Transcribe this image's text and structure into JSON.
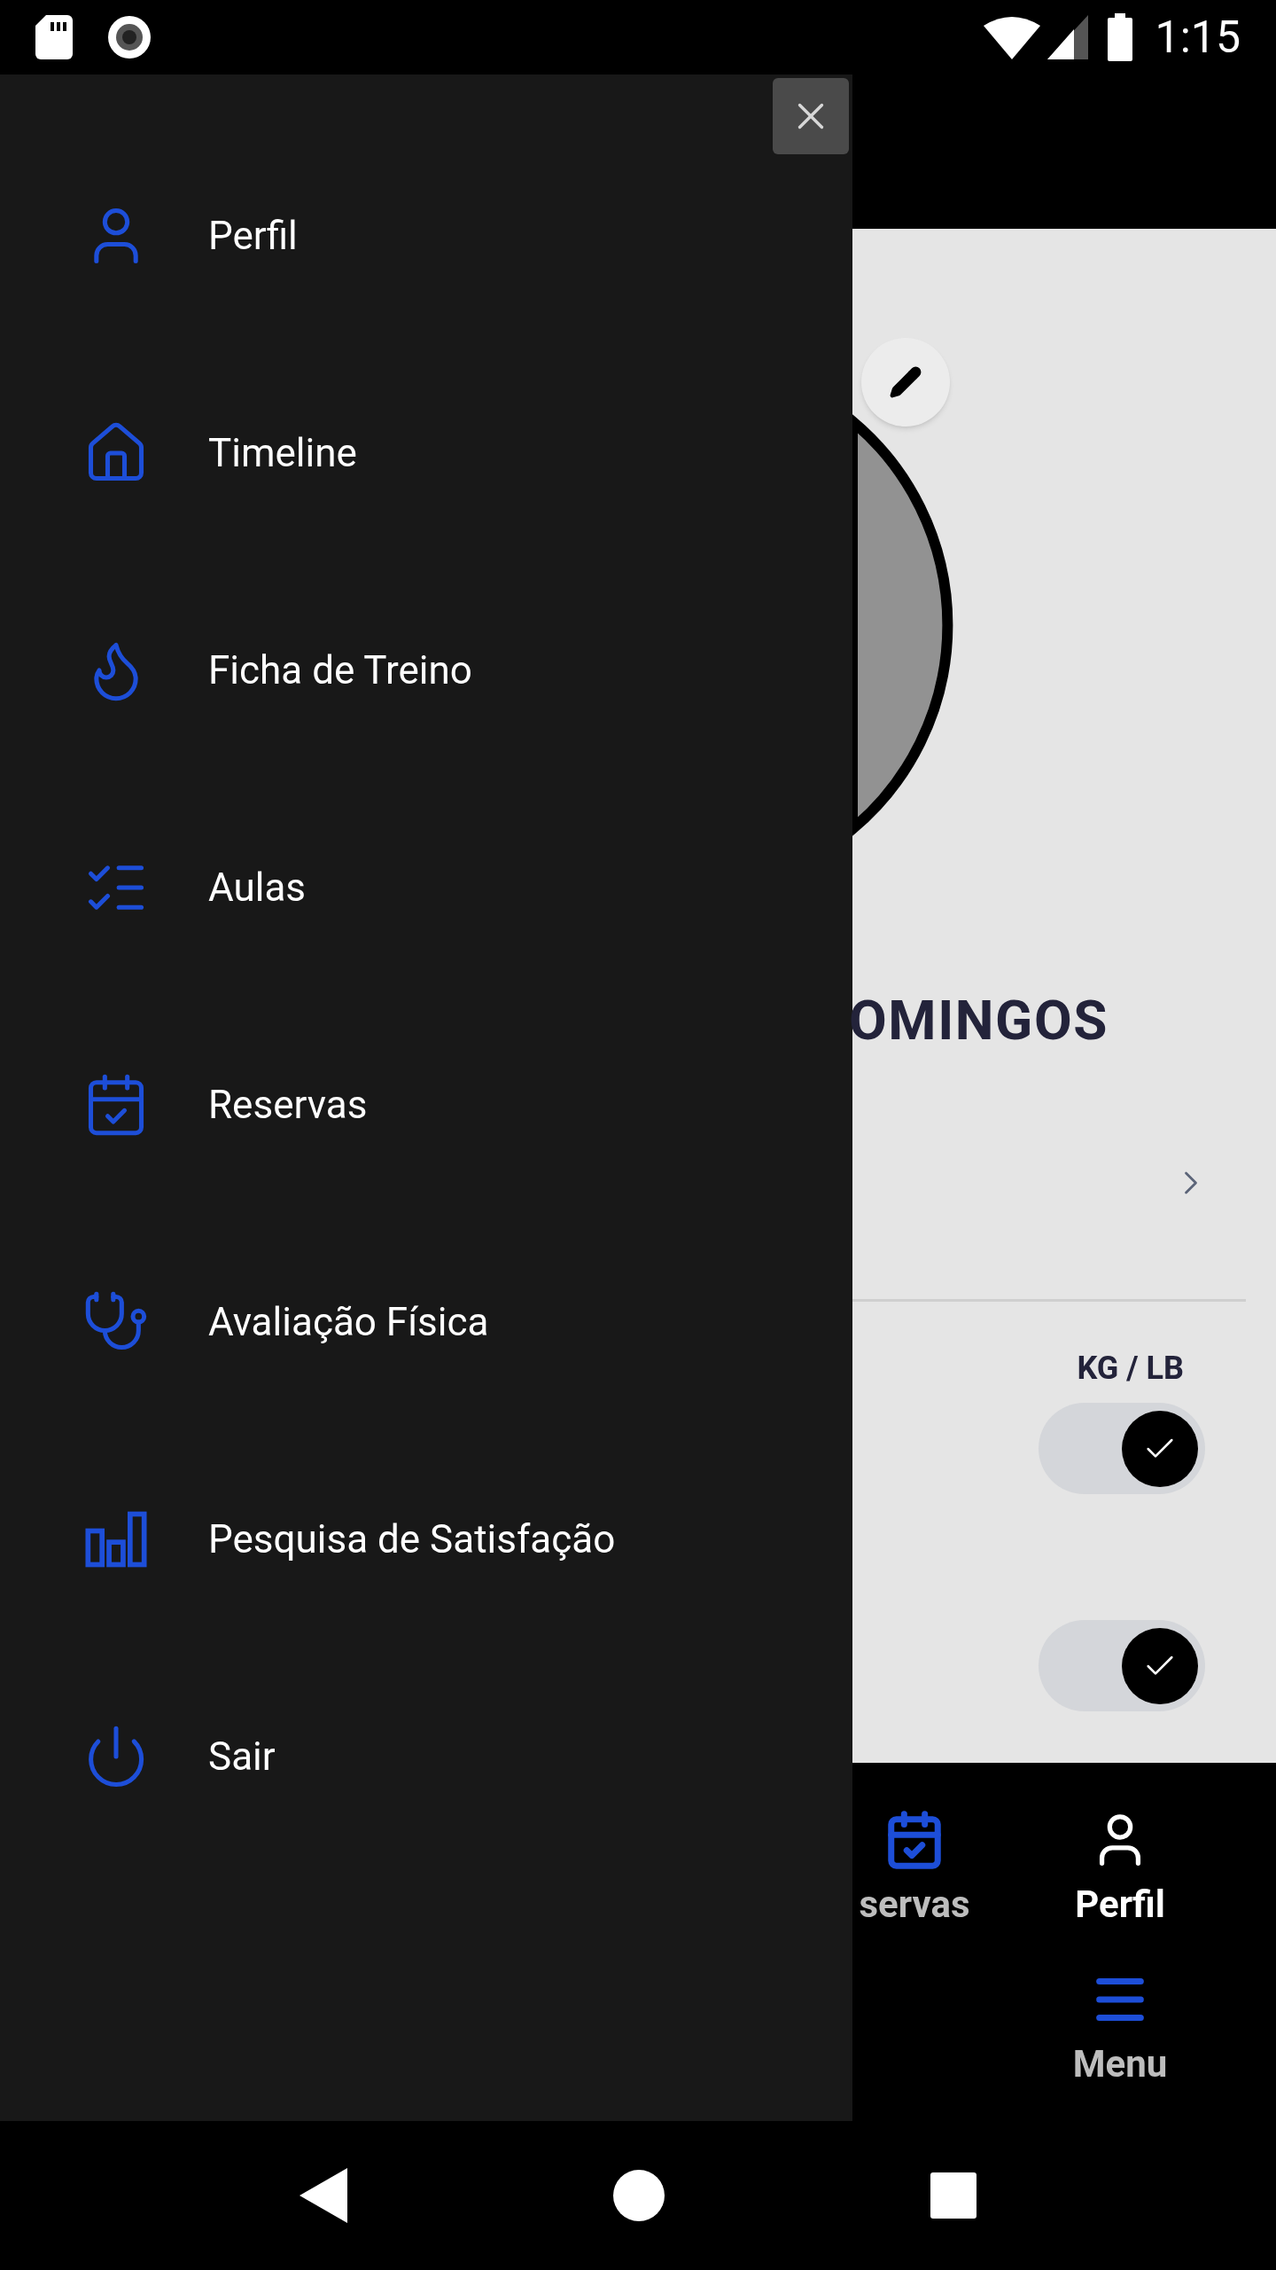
{
  "status_bar": {
    "time": "1:15"
  },
  "drawer": {
    "items": [
      {
        "label": "Perfil"
      },
      {
        "label": "Timeline"
      },
      {
        "label": "Ficha de Treino"
      },
      {
        "label": "Aulas"
      },
      {
        "label": "Reservas"
      },
      {
        "label": "Avaliação Física"
      },
      {
        "label": "Pesquisa de Satisfação"
      },
      {
        "label": "Sair"
      }
    ]
  },
  "profile": {
    "name": "OMINGOS",
    "units_label": "KG / LB",
    "toggles": [
      {
        "on": true
      },
      {
        "on": true
      }
    ]
  },
  "bottom_nav": {
    "items": [
      {
        "label": "servas",
        "selected": false
      },
      {
        "label": "Perfil",
        "selected": true
      },
      {
        "label": "Menu",
        "selected": false
      }
    ]
  }
}
